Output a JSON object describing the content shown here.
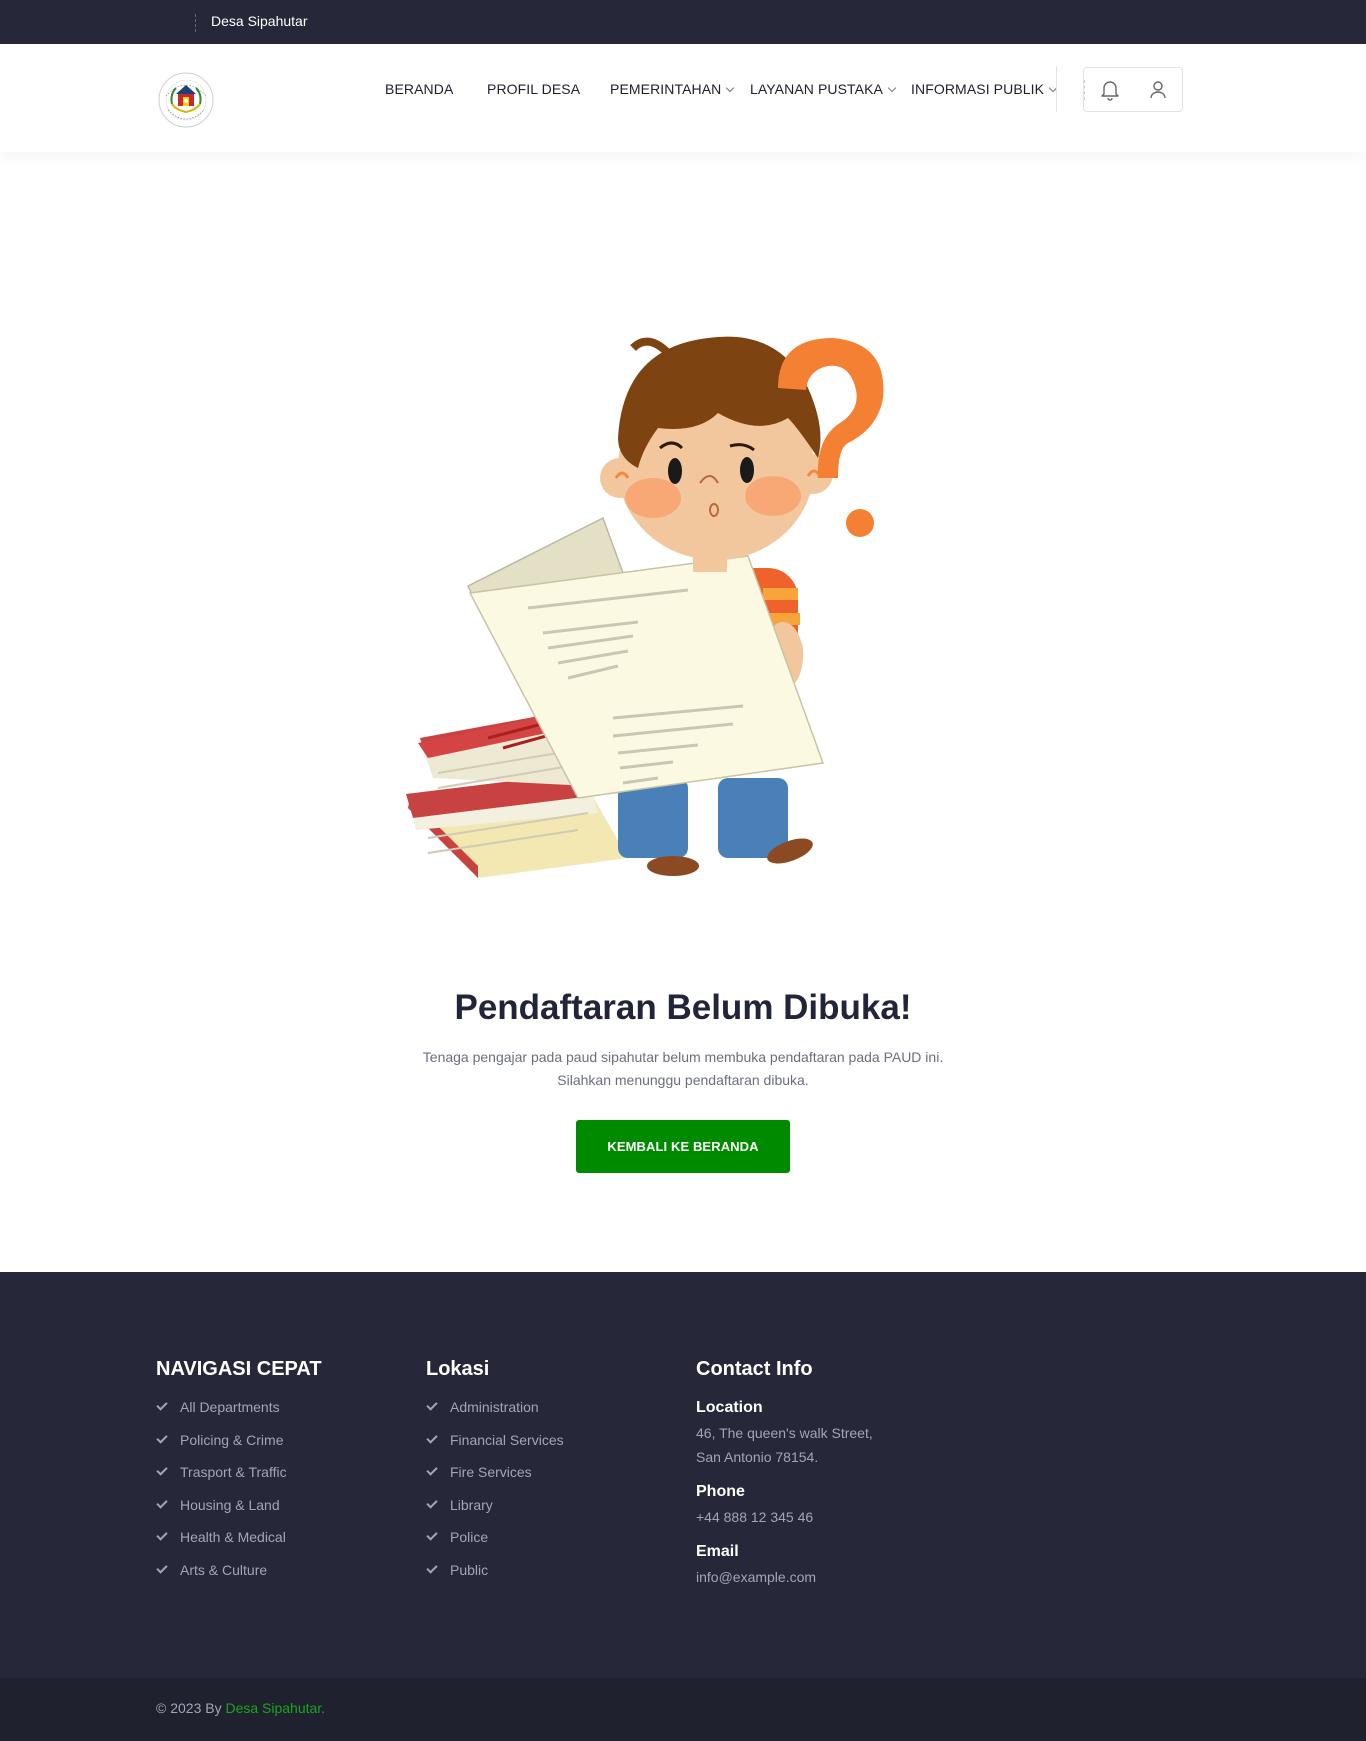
{
  "topbar": {
    "site_name": "Desa Sipahutar"
  },
  "header": {
    "logo_alt": "Sistem Informasi Desa Sipahutar",
    "nav": [
      {
        "label": "BERANDA",
        "dropdown": false
      },
      {
        "label": "PROFIL DESA",
        "dropdown": false
      },
      {
        "label": "PEMERINTAHAN",
        "dropdown": true
      },
      {
        "label": "LAYANAN PUSTAKA",
        "dropdown": true
      },
      {
        "label": "INFORMASI PUBLIK",
        "dropdown": true
      }
    ],
    "icons": [
      "bell-icon",
      "user-icon"
    ]
  },
  "main": {
    "heading": "Pendaftaran Belum Dibuka!",
    "subtext_line1": "Tenaga pengajar pada paud sipahutar belum membuka pendaftaran pada PAUD ini.",
    "subtext_line2": "Silahkan menunggu pendaftaran dibuka.",
    "button_label": "KEMBALI KE BERANDA"
  },
  "footer": {
    "quick_nav": {
      "title": "NAVIGASI CEPAT",
      "items": [
        "All Departments",
        "Policing & Crime",
        "Trasport & Traffic",
        "Housing & Land",
        "Health & Medical",
        "Arts & Culture"
      ]
    },
    "location": {
      "title": "Lokasi",
      "items": [
        "Administration",
        "Financial Services",
        "Fire Services",
        "Library",
        "Police",
        "Public"
      ]
    },
    "contact": {
      "title": "Contact Info",
      "location_label": "Location",
      "location_line1": "46, The queen's walk Street,",
      "location_line2": "San Antonio 78154.",
      "phone_label": "Phone",
      "phone": "+44 888 12 345 46",
      "email_label": "Email",
      "email": "info@example.com"
    },
    "copyright_prefix": "© 2023 By",
    "copyright_brand": "Desa Sipahutar."
  },
  "colors": {
    "dark_bg": "#262839",
    "copy_bg": "#20212f",
    "accent_green": "#008a00",
    "brand_green": "#17a617"
  }
}
